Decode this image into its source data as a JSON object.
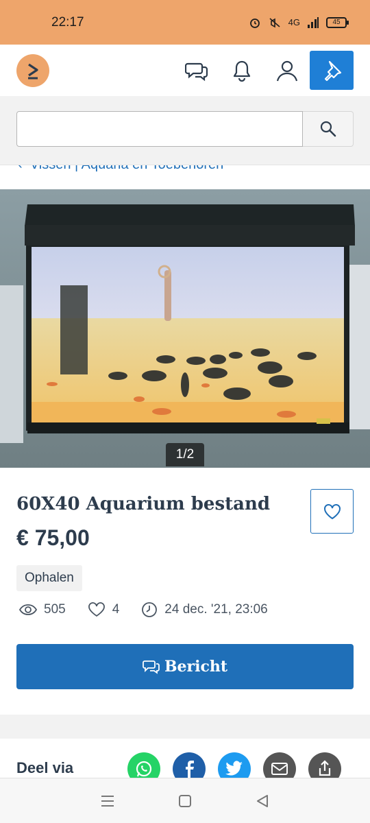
{
  "status_bar": {
    "time": "22:17",
    "network": "4G",
    "battery": "45"
  },
  "search": {
    "value": "",
    "placeholder": ""
  },
  "breadcrumb": {
    "text": "Vissen | Aquaria en Toebehoren"
  },
  "gallery": {
    "counter": "1/2"
  },
  "listing": {
    "title": "60X40 Aquarium bestand",
    "price": "€ 75,00",
    "delivery_tag": "Ophalen",
    "views": "505",
    "favorites": "4",
    "date": "24 dec. '21, 23:06",
    "message_button": "Bericht"
  },
  "share": {
    "label": "Deel via",
    "targets": [
      "whatsapp",
      "facebook",
      "twitter",
      "email",
      "share"
    ]
  },
  "colors": {
    "accent": "#1f6fb8",
    "brand_orange": "#eea56b",
    "whatsapp": "#25d366",
    "facebook": "#1f5fa8",
    "twitter": "#1d9bf0",
    "gray_icon": "#555555"
  }
}
